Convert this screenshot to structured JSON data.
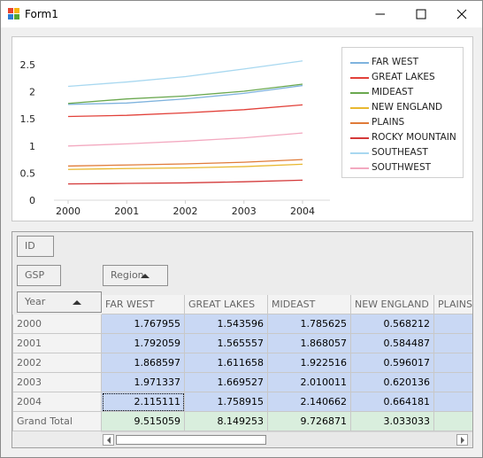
{
  "window": {
    "title": "Form1",
    "app_icon": "winforms-app-icon",
    "minimize_icon": "minimize-icon",
    "maximize_icon": "maximize-icon",
    "close_icon": "close-icon"
  },
  "chart_data": {
    "type": "line",
    "x": [
      "2000",
      "2001",
      "2002",
      "2003",
      "2004"
    ],
    "ylim": [
      0,
      2.5
    ],
    "yticks": [
      "0",
      "0.5",
      "1",
      "1.5",
      "2",
      "2.5"
    ],
    "grid": false,
    "legend_position": "right",
    "series": [
      {
        "name": "FAR WEST",
        "color": "#7fb3de",
        "values": [
          1.767955,
          1.792059,
          1.868597,
          1.971337,
          2.115111
        ]
      },
      {
        "name": "GREAT LAKES",
        "color": "#e2413a",
        "values": [
          1.543596,
          1.565557,
          1.611658,
          1.669527,
          1.758915
        ]
      },
      {
        "name": "MIDEAST",
        "color": "#6aa84f",
        "values": [
          1.785625,
          1.868057,
          1.922516,
          2.010011,
          2.140662
        ]
      },
      {
        "name": "NEW ENGLAND",
        "color": "#e8b830",
        "values": [
          0.568212,
          0.584487,
          0.596017,
          0.620136,
          0.664181
        ]
      },
      {
        "name": "PLAINS",
        "color": "#e07b39",
        "values": [
          0.63,
          0.65,
          0.67,
          0.7,
          0.75
        ]
      },
      {
        "name": "ROCKY MOUNTAIN",
        "color": "#d43a3a",
        "values": [
          0.3,
          0.31,
          0.32,
          0.34,
          0.37
        ]
      },
      {
        "name": "SOUTHEAST",
        "color": "#a8d8f0",
        "values": [
          2.1,
          2.18,
          2.28,
          2.42,
          2.57
        ]
      },
      {
        "name": "SOUTHWEST",
        "color": "#f3a9c0",
        "values": [
          1.0,
          1.04,
          1.09,
          1.15,
          1.24
        ]
      }
    ]
  },
  "pivot": {
    "filter_fields": [
      "ID"
    ],
    "data_fields": [
      "GSP"
    ],
    "column_fields": [
      "Region"
    ],
    "row_fields": [
      "Year"
    ],
    "sort_icon": "sort-ascending-icon",
    "columns": [
      "FAR WEST",
      "GREAT LAKES",
      "MIDEAST",
      "NEW ENGLAND",
      "PLAINS"
    ],
    "rows": [
      {
        "label": "2000",
        "values": [
          "1.767955",
          "1.543596",
          "1.785625",
          "0.568212",
          ""
        ]
      },
      {
        "label": "2001",
        "values": [
          "1.792059",
          "1.565557",
          "1.868057",
          "0.584487",
          ""
        ]
      },
      {
        "label": "2002",
        "values": [
          "1.868597",
          "1.611658",
          "1.922516",
          "0.596017",
          ""
        ]
      },
      {
        "label": "2003",
        "values": [
          "1.971337",
          "1.669527",
          "2.010011",
          "0.620136",
          ""
        ]
      },
      {
        "label": "2004",
        "values": [
          "2.115111",
          "1.758915",
          "2.140662",
          "0.664181",
          ""
        ]
      }
    ],
    "grand_total": {
      "label": "Grand Total",
      "values": [
        "9.515059",
        "8.149253",
        "9.726871",
        "3.033033",
        ""
      ]
    }
  },
  "scrollbar": {
    "left_icon": "scroll-left-arrow-icon",
    "right_icon": "scroll-right-arrow-icon"
  }
}
